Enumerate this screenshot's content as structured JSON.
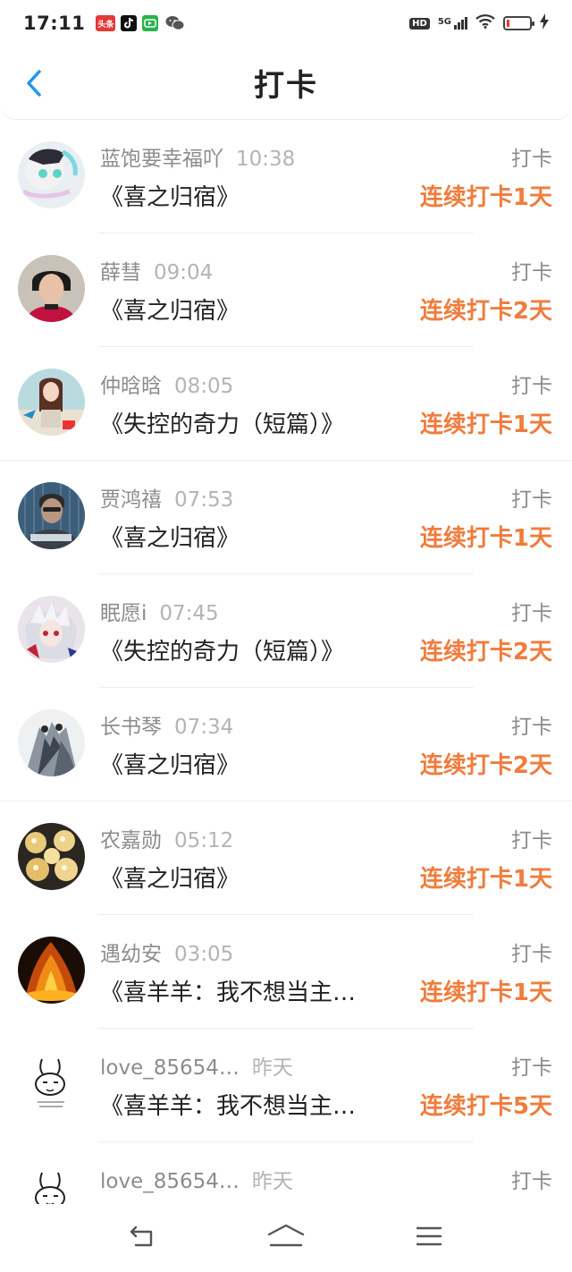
{
  "status_bar": {
    "time": "17:11",
    "apps": [
      "toutiao",
      "tiktok",
      "iqiyi",
      "wechat"
    ],
    "toutiao_text": "头条",
    "hd": "HD",
    "network": "5G"
  },
  "nav": {
    "title": "打卡",
    "back_icon": "back-chevron-icon"
  },
  "colors": {
    "accent": "#f07c3c",
    "back": "#2196f3",
    "username": "#8c8c8c",
    "time": "#b4b4b4",
    "title": "#222222"
  },
  "checkins": [
    {
      "user": "蓝饱要幸福吖",
      "time": "10:38",
      "book": "《喜之归宿》",
      "action": "打卡",
      "streak": "连续打卡1天"
    },
    {
      "user": "薛彗",
      "time": "09:04",
      "book": "《喜之归宿》",
      "action": "打卡",
      "streak": "连续打卡2天"
    },
    {
      "user": "仲晗晗",
      "time": "08:05",
      "book": "《失控的奇力（短篇）》",
      "action": "打卡",
      "streak": "连续打卡1天"
    },
    {
      "user": "贾鸿禧",
      "time": "07:53",
      "book": "《喜之归宿》",
      "action": "打卡",
      "streak": "连续打卡1天"
    },
    {
      "user": "眠愿i",
      "time": "07:45",
      "book": "《失控的奇力（短篇）》",
      "action": "打卡",
      "streak": "连续打卡2天"
    },
    {
      "user": "长书琴",
      "time": "07:34",
      "book": "《喜之归宿》",
      "action": "打卡",
      "streak": "连续打卡2天"
    },
    {
      "user": "农嘉勋",
      "time": "05:12",
      "book": "《喜之归宿》",
      "action": "打卡",
      "streak": "连续打卡1天"
    },
    {
      "user": "遇幼安",
      "time": "03:05",
      "book": "《喜羊羊：我不想当主…",
      "action": "打卡",
      "streak": "连续打卡1天"
    },
    {
      "user": "love_85654…",
      "time": "昨天",
      "book": "《喜羊羊：我不想当主…",
      "action": "打卡",
      "streak": "连续打卡5天"
    },
    {
      "user": "love_85654…",
      "time": "昨天",
      "book": "",
      "action": "打卡",
      "streak": ""
    }
  ],
  "bottom_nav": {
    "back": "nav-back-icon",
    "home": "nav-home-icon",
    "menu": "nav-menu-icon"
  }
}
